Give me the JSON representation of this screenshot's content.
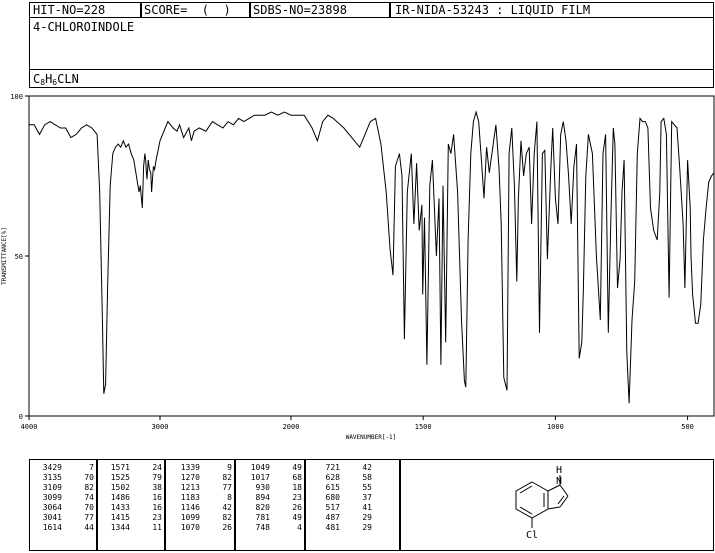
{
  "header": {
    "hit": "HIT-NO=228",
    "score": "SCORE=  (  )",
    "sdbs": "SDBS-NO=23898",
    "nida": "IR-NIDA-53243 : LIQUID FILM",
    "compound": "4-CHLOROINDOLE",
    "formula_parts": [
      "C",
      "8",
      "H",
      "6",
      "CLN"
    ]
  },
  "chart_data": {
    "type": "line",
    "xlabel": "WAVENUMBER[-1]",
    "ylabel": "TRANSMITTANCE[%]",
    "xlim": [
      4000,
      400
    ],
    "ylim": [
      0,
      100
    ],
    "xticks": [
      4000,
      3000,
      2000,
      1500,
      1000,
      500
    ],
    "yticks": [
      0,
      50,
      100
    ],
    "x": [
      4000,
      3960,
      3920,
      3880,
      3840,
      3800,
      3760,
      3720,
      3680,
      3640,
      3600,
      3560,
      3520,
      3480,
      3460,
      3440,
      3429,
      3415,
      3400,
      3380,
      3360,
      3340,
      3320,
      3300,
      3280,
      3260,
      3240,
      3220,
      3200,
      3180,
      3160,
      3150,
      3135,
      3125,
      3115,
      3109,
      3104,
      3099,
      3090,
      3080,
      3070,
      3064,
      3050,
      3041,
      3030,
      3000,
      2980,
      2960,
      2940,
      2920,
      2900,
      2870,
      2850,
      2820,
      2780,
      2760,
      2740,
      2700,
      2650,
      2600,
      2560,
      2520,
      2480,
      2440,
      2400,
      2360,
      2320,
      2280,
      2240,
      2200,
      2150,
      2100,
      2050,
      2000,
      1950,
      1920,
      1900,
      1880,
      1860,
      1840,
      1800,
      1760,
      1740,
      1720,
      1700,
      1680,
      1660,
      1640,
      1625,
      1614,
      1605,
      1590,
      1580,
      1571,
      1560,
      1545,
      1535,
      1525,
      1515,
      1505,
      1502,
      1495,
      1486,
      1475,
      1465,
      1450,
      1440,
      1433,
      1425,
      1415,
      1405,
      1395,
      1385,
      1370,
      1355,
      1344,
      1339,
      1330,
      1320,
      1310,
      1300,
      1290,
      1280,
      1270,
      1260,
      1250,
      1240,
      1225,
      1213,
      1205,
      1195,
      1183,
      1175,
      1165,
      1155,
      1146,
      1140,
      1130,
      1120,
      1110,
      1099,
      1090,
      1080,
      1070,
      1060,
      1049,
      1040,
      1030,
      1017,
      1010,
      1000,
      990,
      980,
      970,
      960,
      950,
      940,
      930,
      920,
      910,
      900,
      894,
      885,
      875,
      860,
      845,
      830,
      820,
      810,
      800,
      790,
      781,
      775,
      765,
      755,
      748,
      740,
      730,
      721,
      710,
      700,
      690,
      680,
      670,
      660,
      650,
      640,
      628,
      615,
      605,
      600,
      590,
      580,
      570,
      560,
      550,
      540,
      530,
      517,
      510,
      500,
      490,
      487,
      481,
      470,
      460,
      450,
      440,
      430,
      420,
      410,
      400
    ],
    "y": [
      91,
      91,
      88,
      91,
      92,
      91,
      90,
      90,
      87,
      88,
      90,
      91,
      90,
      88,
      70,
      30,
      7,
      10,
      40,
      72,
      82,
      84,
      85,
      84,
      86,
      84,
      85,
      82,
      80,
      75,
      70,
      72,
      65,
      78,
      82,
      80,
      76,
      74,
      80,
      77,
      76,
      70,
      78,
      77,
      80,
      86,
      88,
      90,
      92,
      91,
      90,
      89,
      91,
      87,
      90,
      86,
      89,
      90,
      89,
      92,
      91,
      90,
      92,
      91,
      93,
      92,
      93,
      94,
      94,
      94,
      95,
      94,
      95,
      94,
      94,
      90,
      86,
      92,
      94,
      93,
      90,
      86,
      84,
      88,
      92,
      93,
      85,
      70,
      52,
      44,
      78,
      82,
      75,
      24,
      70,
      82,
      60,
      79,
      58,
      66,
      38,
      62,
      16,
      72,
      80,
      50,
      68,
      16,
      72,
      23,
      85,
      82,
      88,
      70,
      30,
      11,
      9,
      55,
      82,
      92,
      95,
      92,
      80,
      68,
      84,
      76,
      82,
      91,
      77,
      60,
      12,
      8,
      82,
      90,
      72,
      42,
      68,
      86,
      75,
      82,
      84,
      60,
      82,
      92,
      26,
      82,
      83,
      49,
      78,
      90,
      68,
      60,
      88,
      92,
      86,
      75,
      60,
      78,
      85,
      18,
      23,
      40,
      75,
      88,
      82,
      50,
      30,
      82,
      88,
      26,
      62,
      90,
      85,
      40,
      49,
      70,
      80,
      20,
      4,
      30,
      42,
      82,
      93,
      92,
      92,
      90,
      65,
      58,
      55,
      70,
      92,
      93,
      88,
      37,
      92,
      91,
      90,
      78,
      60,
      40,
      80,
      65,
      50,
      38,
      29,
      29,
      35,
      55,
      65,
      73,
      75,
      76
    ]
  },
  "peak_table": [
    [
      [
        "3429",
        "7"
      ],
      [
        "3135",
        "70"
      ],
      [
        "3109",
        "82"
      ],
      [
        "3099",
        "74"
      ],
      [
        "3064",
        "70"
      ],
      [
        "3041",
        "77"
      ],
      [
        "1614",
        "44"
      ]
    ],
    [
      [
        "1571",
        "24"
      ],
      [
        "1525",
        "79"
      ],
      [
        "1502",
        "38"
      ],
      [
        "1486",
        "16"
      ],
      [
        "1433",
        "16"
      ],
      [
        "1415",
        "23"
      ],
      [
        "1344",
        "11"
      ]
    ],
    [
      [
        "1339",
        "9"
      ],
      [
        "1270",
        "82"
      ],
      [
        "1213",
        "77"
      ],
      [
        "1183",
        "8"
      ],
      [
        "1146",
        "42"
      ],
      [
        "1099",
        "82"
      ],
      [
        "1070",
        "26"
      ]
    ],
    [
      [
        "1049",
        "49"
      ],
      [
        "1017",
        "68"
      ],
      [
        "930",
        "18"
      ],
      [
        "894",
        "23"
      ],
      [
        "820",
        "26"
      ],
      [
        "781",
        "49"
      ],
      [
        "748",
        "4"
      ]
    ],
    [
      [
        "721",
        "42"
      ],
      [
        "628",
        "58"
      ],
      [
        "615",
        "55"
      ],
      [
        "680",
        "37"
      ],
      [
        "517",
        "41"
      ],
      [
        "487",
        "29"
      ],
      [
        "481",
        "29"
      ]
    ]
  ],
  "structure": {
    "atom_h": "H",
    "atom_n": "N",
    "atom_cl": "Cl"
  }
}
